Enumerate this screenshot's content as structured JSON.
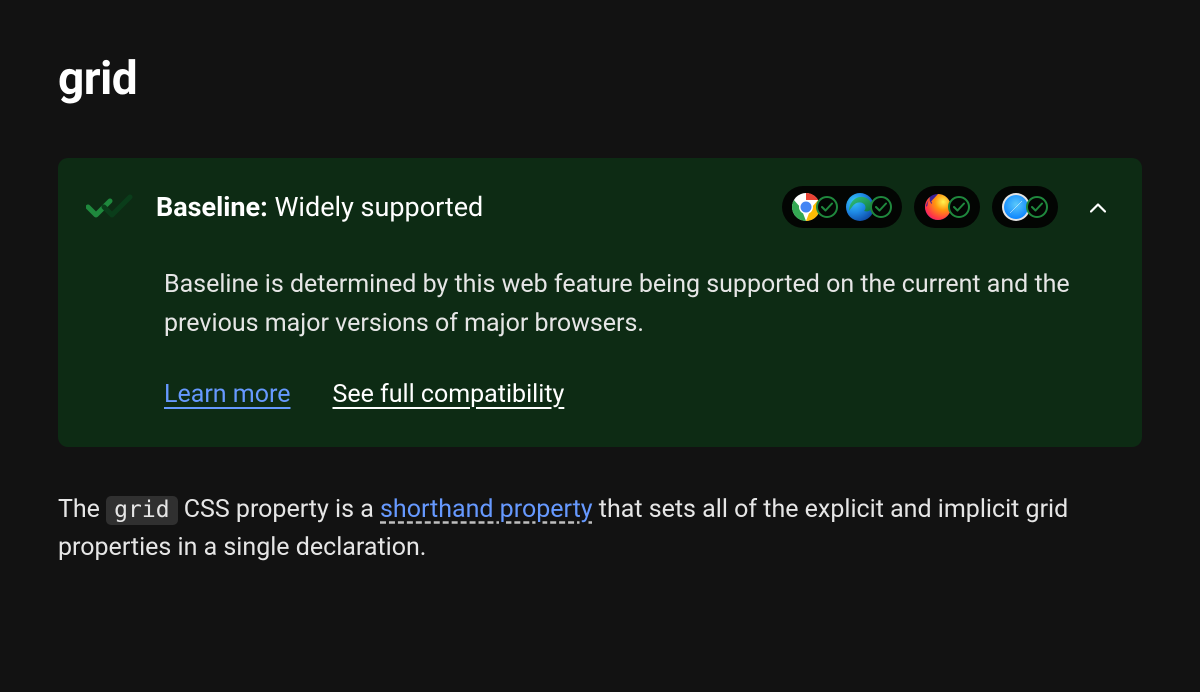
{
  "title": "grid",
  "baseline": {
    "label": "Baseline:",
    "status": "Widely supported",
    "description": "Baseline is determined by this web feature being supported on the current and the previous major versions of major browsers.",
    "learn_more": "Learn more",
    "see_full": "See full compatibility",
    "browsers": [
      "chrome",
      "edge",
      "firefox",
      "safari"
    ]
  },
  "intro": {
    "prefix": "The ",
    "code": "grid",
    "mid": " CSS property is a ",
    "link": "shorthand property",
    "suffix": " that sets all of the explicit and implicit grid properties in a single declaration."
  }
}
